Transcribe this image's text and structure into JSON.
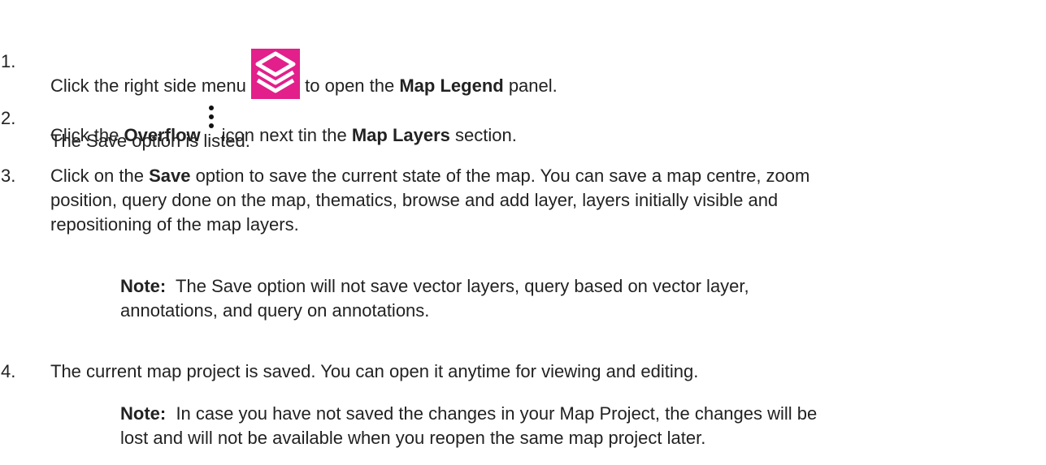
{
  "steps": [
    {
      "number": "1.",
      "before": "Click the right side menu",
      "icon": "layers-icon",
      "after_pre": " to open the ",
      "bold": "Map Legend",
      "after_post": " panel."
    },
    {
      "number": "2.",
      "pre": "Click the ",
      "bold1": "Overflow",
      "icon": "overflow-vertical-icon",
      "mid": "icon next tin the ",
      "bold2": "Map Layers",
      "post": " section.",
      "line2": "The Save option is listed."
    },
    {
      "number": "3.",
      "pre": "Click on the ",
      "bold": "Save",
      "post_line1": " option to save the current state of the map. You can save a map centre, zoom",
      "line2": "position, query done on the map, thematics, browse and add layer, layers initially visible and",
      "line3": "repositioning of the map layers."
    },
    {
      "number": "4.",
      "line1": "The current map project is saved. You can open it anytime for viewing and editing."
    }
  ],
  "notes": [
    {
      "label": "Note:",
      "line1": "  The Save option will not save vector layers, query based on vector layer,",
      "line2": "annotations, and query on annotations."
    },
    {
      "label": "Note:",
      "line1": "  In case you have not saved the changes in your Map Project, the changes will be",
      "line2": "lost and will not be available when you reopen the same map project later."
    }
  ],
  "colors": {
    "text": "#222222",
    "icon_bg": "#e21f8a",
    "icon_fg": "#ffffff"
  }
}
